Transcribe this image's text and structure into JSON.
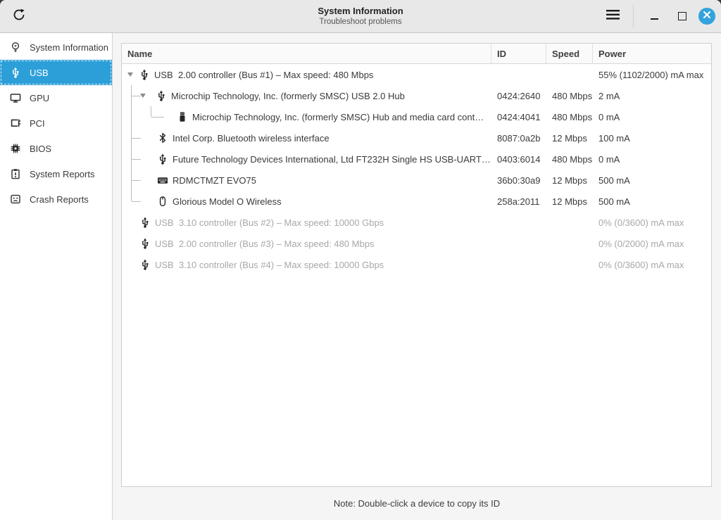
{
  "titlebar": {
    "title": "System Information",
    "subtitle": "Troubleshoot problems"
  },
  "sidebar": {
    "items": [
      {
        "label": "System Information",
        "icon": "lightbulb-icon",
        "selected": false
      },
      {
        "label": "USB",
        "icon": "usb-icon",
        "selected": true
      },
      {
        "label": "GPU",
        "icon": "monitor-icon",
        "selected": false
      },
      {
        "label": "PCI",
        "icon": "pci-card-icon",
        "selected": false
      },
      {
        "label": "BIOS",
        "icon": "chip-icon",
        "selected": false
      },
      {
        "label": "System Reports",
        "icon": "clipboard-icon",
        "selected": false
      },
      {
        "label": "Crash Reports",
        "icon": "sad-face-icon",
        "selected": false
      }
    ]
  },
  "table": {
    "columns": {
      "name": "Name",
      "id": "ID",
      "speed": "Speed",
      "power": "Power"
    },
    "rows": [
      {
        "name": "USB  2.00 controller (Bus #1) – Max speed: 480 Mbps",
        "id": "",
        "speed": "",
        "power": "55% (1102/2000) mA max",
        "icon": "usb-icon",
        "grey": false
      },
      {
        "name": "Microchip Technology, Inc. (formerly SMSC) USB 2.0 Hub",
        "id": "0424:2640",
        "speed": "480 Mbps",
        "power": "2 mA",
        "icon": "usb-icon",
        "grey": false
      },
      {
        "name": "Microchip Technology, Inc. (formerly SMSC) Hub and media card cont…",
        "id": "0424:4041",
        "speed": "480 Mbps",
        "power": "0 mA",
        "icon": "flash-drive-icon",
        "grey": false
      },
      {
        "name": "Intel Corp. Bluetooth wireless interface",
        "id": "8087:0a2b",
        "speed": "12 Mbps",
        "power": "100 mA",
        "icon": "bluetooth-icon",
        "grey": false
      },
      {
        "name": "Future Technology Devices International, Ltd FT232H Single HS USB-UART…",
        "id": "0403:6014",
        "speed": "480 Mbps",
        "power": "0 mA",
        "icon": "usb-icon",
        "grey": false
      },
      {
        "name": "RDMCTMZT EVO75",
        "id": "36b0:30a9",
        "speed": "12 Mbps",
        "power": "500 mA",
        "icon": "keyboard-icon",
        "grey": false
      },
      {
        "name": "Glorious Model O Wireless",
        "id": "258a:2011",
        "speed": "12 Mbps",
        "power": "500 mA",
        "icon": "mouse-icon",
        "grey": false
      },
      {
        "name": "USB  3.10 controller (Bus #2) – Max speed: 10000 Gbps",
        "id": "",
        "speed": "",
        "power": "0% (0/3600) mA max",
        "icon": "usb-icon",
        "grey": true
      },
      {
        "name": "USB  2.00 controller (Bus #3) – Max speed: 480 Mbps",
        "id": "",
        "speed": "",
        "power": "0% (0/2000) mA max",
        "icon": "usb-icon",
        "grey": true
      },
      {
        "name": "USB  3.10 controller (Bus #4) – Max speed: 10000 Gbps",
        "id": "",
        "speed": "",
        "power": "0% (0/3600) mA max",
        "icon": "usb-icon",
        "grey": true
      }
    ]
  },
  "footer": {
    "note": "Note: Double-click a device to copy its ID"
  },
  "colors": {
    "accent": "#2d9fd8",
    "close_button": "#33a3dc",
    "grey_text": "#a8a8a8"
  }
}
